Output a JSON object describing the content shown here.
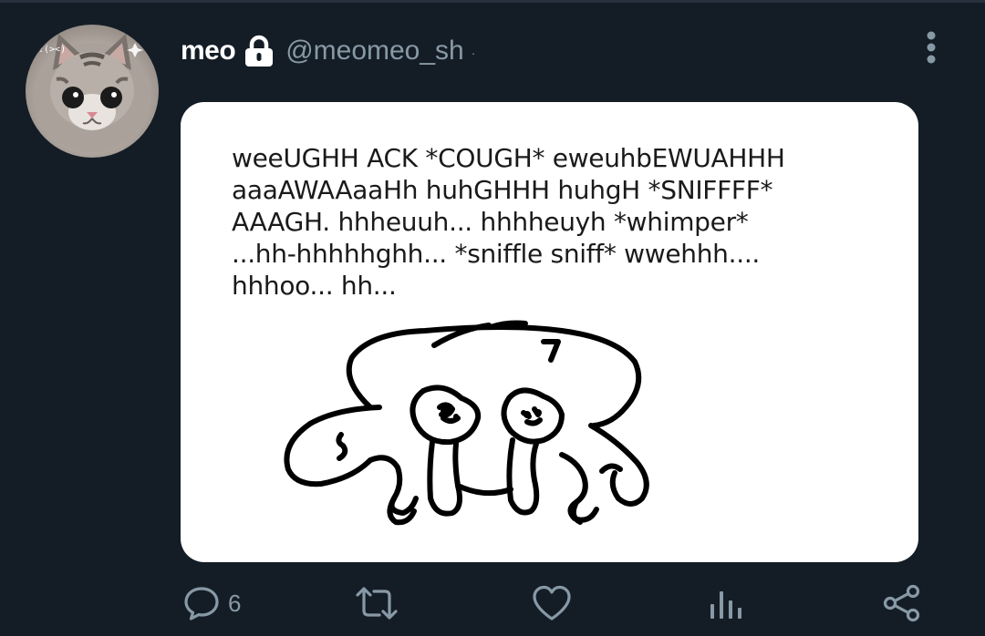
{
  "tweet": {
    "display_name": "meo",
    "handle": "@meomeo_sh",
    "handle_separator": "·",
    "protected": true,
    "avatar_icon": "kitten-avatar-icon",
    "media": {
      "text_lines": [
        "weeUGHH ACK *COUGH* eweuhbEWUAHHH",
        "aaaAWAAaaHh huhGHHH huhgH *SNIFFFF*",
        "AAAGH. hhheuuh... hhhheuyh *whimper*",
        "...hh-hhhhhghh... *sniffle sniff* wwehhh....",
        "hhhoo... hh..."
      ],
      "drawing_icon": "crying-blob-doodle"
    },
    "actions": {
      "reply_count": "6",
      "reply_icon": "reply-icon",
      "retweet_icon": "retweet-icon",
      "like_icon": "heart-icon",
      "analytics_icon": "analytics-icon",
      "share_icon": "share-icon",
      "more_icon": "more-vertical-icon"
    }
  },
  "colors": {
    "background": "#141d26",
    "secondary_text": "#8899a6",
    "primary_text": "#ffffff",
    "card_background": "#ffffff"
  }
}
